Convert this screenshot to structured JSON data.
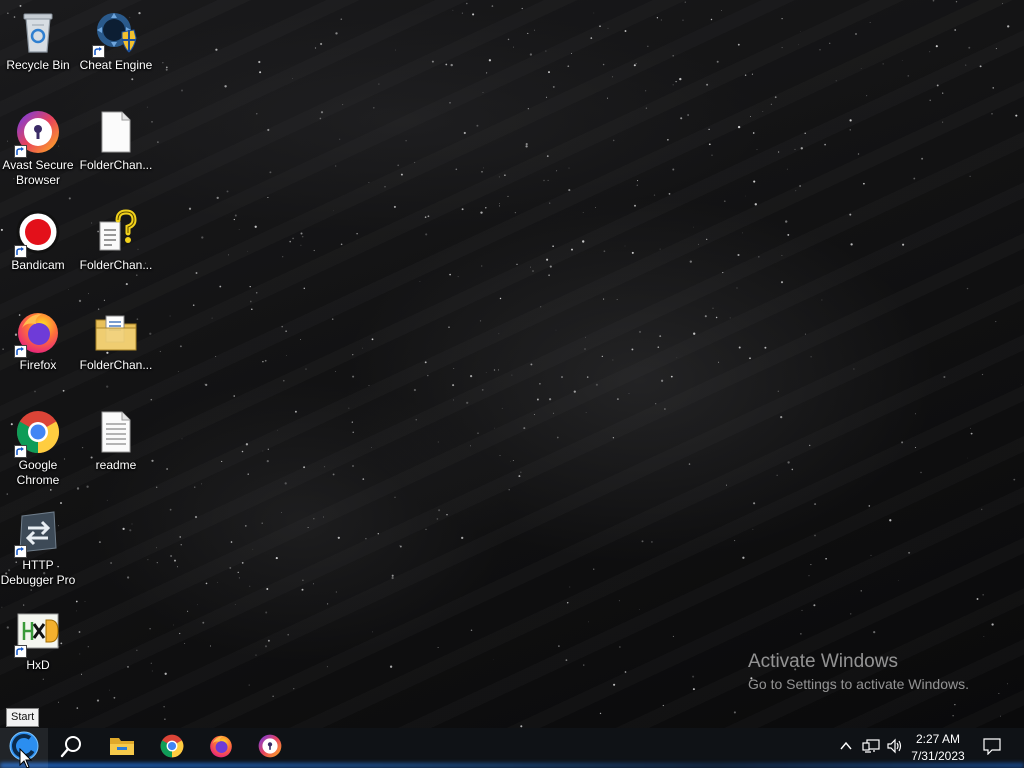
{
  "desktop": {
    "icons": [
      {
        "label": "Recycle Bin",
        "icon": "recycle-bin-icon"
      },
      {
        "label": "Cheat Engine",
        "icon": "cheat-engine-icon"
      },
      {
        "label": "Avast Secure Browser",
        "icon": "avast-secure-browser-icon"
      },
      {
        "label": "FolderChan...",
        "icon": "blank-document-icon"
      },
      {
        "label": "Bandicam",
        "icon": "bandicam-icon"
      },
      {
        "label": "FolderChan...",
        "icon": "help-document-icon"
      },
      {
        "label": "Firefox",
        "icon": "firefox-icon"
      },
      {
        "label": "FolderChan...",
        "icon": "folder-document-icon"
      },
      {
        "label": "Google Chrome",
        "icon": "chrome-icon"
      },
      {
        "label": "readme",
        "icon": "text-document-icon"
      },
      {
        "label": "HTTP Debugger Pro",
        "icon": "http-debugger-icon"
      },
      {
        "label": "HxD",
        "icon": "hxd-icon"
      }
    ]
  },
  "watermark": {
    "title": "Activate Windows",
    "subtitle": "Go to Settings to activate Windows."
  },
  "tooltip": {
    "text": "Start"
  },
  "taskbar": {
    "pinned": [
      {
        "name": "start-button",
        "icon": "windows-start-icon"
      },
      {
        "name": "search-button",
        "icon": "search-icon"
      },
      {
        "name": "file-explorer-button",
        "icon": "folder-icon"
      },
      {
        "name": "chrome-taskbar-button",
        "icon": "chrome-icon"
      },
      {
        "name": "firefox-taskbar-button",
        "icon": "firefox-icon"
      },
      {
        "name": "avast-taskbar-button",
        "icon": "avast-secure-browser-icon"
      }
    ],
    "tray": {
      "icons": [
        "chevron-up-icon",
        "network-icon",
        "volume-icon"
      ],
      "time": "2:27 AM",
      "date": "7/31/2023",
      "notification_icon": "action-center-icon"
    }
  },
  "colors": {
    "taskbar": "#0f1216",
    "accent": "#1e6edc"
  }
}
